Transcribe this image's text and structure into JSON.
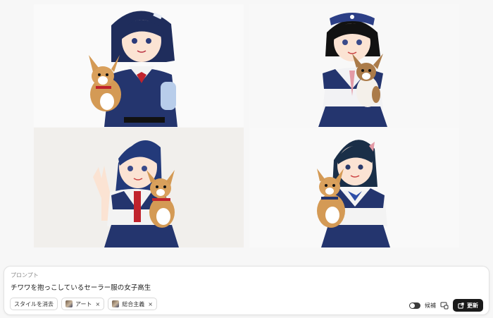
{
  "gallery": {
    "images": [
      {
        "alt": "chihuahua girl 1"
      },
      {
        "alt": "chihuahua girl 2"
      },
      {
        "alt": "chihuahua girl 3"
      },
      {
        "alt": "chihuahua girl 4"
      }
    ]
  },
  "prompt": {
    "label": "プロンプト",
    "text": "チワワを抱っこしているセーラー服の女子高生"
  },
  "styles": {
    "clear_label": "スタイルを消去",
    "chips": [
      {
        "label": "アート",
        "remove": "×"
      },
      {
        "label": "総合主義",
        "remove": "×"
      }
    ]
  },
  "controls": {
    "toggle_label": "候補",
    "toggle_on": true,
    "update_label": "更新"
  },
  "colors": {
    "uniform_navy": "#24356e",
    "hair_navy": "#1f2d5c",
    "dog_tan": "#d49a55",
    "button_dark": "#1a1a1a"
  }
}
